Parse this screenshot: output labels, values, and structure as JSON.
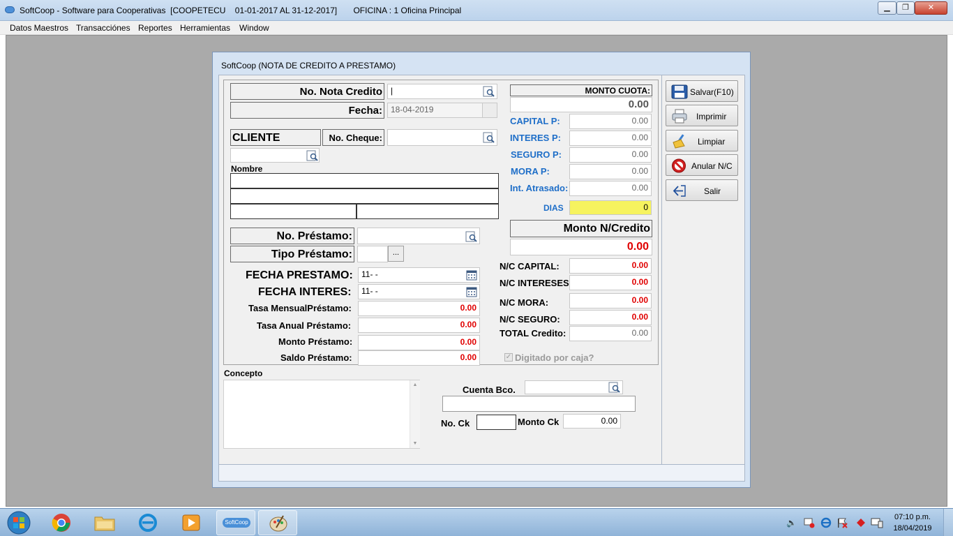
{
  "window": {
    "title": "SoftCoop - Software para Cooperativas  [COOPETECU    01-01-2017 AL 31-12-2017]       OFICINA : 1 Oficina Principal"
  },
  "menu": [
    "Datos Maestros",
    "Transacciónes",
    "Reportes",
    "Herramientas",
    "Window"
  ],
  "dialog": {
    "title": "SoftCoop (NOTA DE CREDITO A PRESTAMO)",
    "no_nota_label": "No. Nota Credito",
    "no_nota_value": "|",
    "fecha_label": "Fecha:",
    "fecha_value": "18-04-2019",
    "cliente_label": "CLIENTE",
    "no_cheque_label": "No. Cheque:",
    "nombre_label": "Nombre",
    "no_prestamo_label": "No. Préstamo:",
    "tipo_prestamo_label": "Tipo Préstamo:",
    "tipo_btn": "...",
    "fecha_prestamo_label": "FECHA PRESTAMO:",
    "fecha_prestamo_value": "11-  -",
    "fecha_interes_label": "FECHA INTERES:",
    "fecha_interes_value": "11-  -",
    "tasa_mensual_label": "Tasa MensualPréstamo:",
    "tasa_mensual_value": "0.00",
    "tasa_anual_label": "Tasa Anual Préstamo:",
    "tasa_anual_value": "0.00",
    "monto_prestamo_label": "Monto Préstamo:",
    "monto_prestamo_value": "0.00",
    "saldo_prestamo_label": "Saldo Préstamo:",
    "saldo_prestamo_value": "0.00",
    "monto_cuota_label": "MONTO CUOTA:",
    "monto_cuota_value": "0.00",
    "capital_p_label": "CAPITAL P:",
    "capital_p_value": "0.00",
    "interes_p_label": "INTERES P:",
    "interes_p_value": "0.00",
    "seguro_p_label": "SEGURO P:",
    "seguro_p_value": "0.00",
    "mora_p_label": "MORA P:",
    "mora_p_value": "0.00",
    "int_atrasado_label": "Int. Atrasado:",
    "int_atrasado_value": "0.00",
    "dias_label": "DIAS",
    "dias_value": "0",
    "monto_nc_label": "Monto N/Credito",
    "monto_nc_value": "0.00",
    "nc_capital_label": "N/C CAPITAL:",
    "nc_capital_value": "0.00",
    "nc_intereses_label": "N/C INTERESES:",
    "nc_intereses_value": "0.00",
    "nc_mora_label": "N/C MORA:",
    "nc_mora_value": "0.00",
    "nc_seguro_label": "N/C SEGURO:",
    "nc_seguro_value": "0.00",
    "total_credito_label": "TOTAL Credito:",
    "total_credito_value": "0.00",
    "digitado_label": "Digitado por caja?",
    "concepto_label": "Concepto",
    "cuenta_bco_label": "Cuenta Bco.",
    "no_ck_label": "No. Ck",
    "monto_ck_label": "Monto Ck",
    "monto_ck_value": "0.00",
    "buttons": {
      "salvar": "Salvar(F10)",
      "imprimir": "Imprimir",
      "limpiar": "Limpiar",
      "anular": "Anular N/C",
      "salir": "Salir"
    }
  },
  "taskbar": {
    "time": "07:10 p.m.",
    "date": "18/04/2019",
    "softcoop_label": "SoftCoop"
  },
  "colors": {
    "blue_label": "#1e6ec8",
    "red_value": "#e00000",
    "yellow_field": "#f6f35f"
  }
}
